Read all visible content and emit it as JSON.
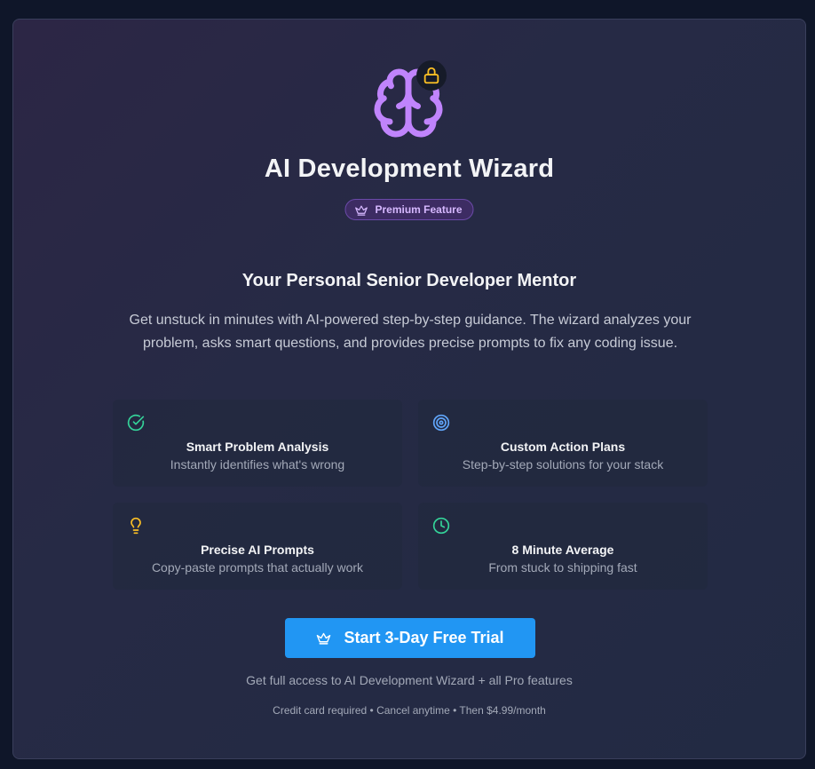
{
  "header": {
    "icon": "brain-icon",
    "lock_icon": "lock-icon",
    "title": "AI Development Wizard",
    "badge": {
      "icon": "crown-icon",
      "label": "Premium Feature"
    }
  },
  "intro": {
    "subtitle": "Your Personal Senior Developer Mentor",
    "description": "Get unstuck in minutes with AI-powered step-by-step guidance. The wizard analyzes your problem, asks smart questions, and provides precise prompts to fix any coding issue."
  },
  "features": [
    {
      "icon": "check-circle-icon",
      "title": "Smart Problem Analysis",
      "description": "Instantly identifies what's wrong",
      "color": "#34d399"
    },
    {
      "icon": "target-icon",
      "title": "Custom Action Plans",
      "description": "Step-by-step solutions for your stack",
      "color": "#60a5fa"
    },
    {
      "icon": "lightbulb-icon",
      "title": "Precise AI Prompts",
      "description": "Copy-paste prompts that actually work",
      "color": "#fbbf24"
    },
    {
      "icon": "clock-icon",
      "title": "8 Minute Average",
      "description": "From stuck to shipping fast",
      "color": "#34d399"
    }
  ],
  "cta": {
    "icon": "crown-icon",
    "label": "Start 3-Day Free Trial"
  },
  "footer": {
    "access_note": "Get full access to AI Development Wizard + all Pro features",
    "fine_print": "Credit card required • Cancel anytime • Then $4.99/month"
  },
  "colors": {
    "brand_purple": "#c084fc",
    "accent_blue": "#2196f3",
    "lock_yellow": "#fbbf24",
    "background": "#262a45"
  }
}
